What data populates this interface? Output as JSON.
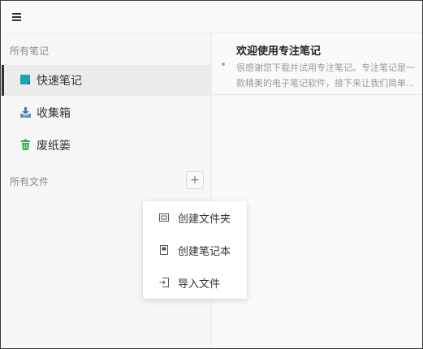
{
  "sidebar": {
    "section_notes": "所有笔记",
    "items": [
      {
        "label": "快速笔记",
        "icon": "quick-note-icon",
        "color": "#1aa3b8",
        "active": true
      },
      {
        "label": "收集箱",
        "icon": "inbox-download-icon",
        "color": "#3d7fc1",
        "active": false
      },
      {
        "label": "废纸篓",
        "icon": "trash-icon",
        "color": "#2eaa4a",
        "active": false
      }
    ],
    "section_files": "所有文件",
    "add_label": "+"
  },
  "dropdown": {
    "items": [
      {
        "label": "创建文件夹",
        "icon": "folder-create-icon"
      },
      {
        "label": "创建笔记本",
        "icon": "notebook-create-icon"
      },
      {
        "label": "导入文件",
        "icon": "import-file-icon"
      }
    ]
  },
  "notes": [
    {
      "title": "欢迎使用专注笔记",
      "excerpt": "很感谢您下载并试用专注笔记。专注笔记是一款精美的电子笔记软件，接下来让我们简单..."
    }
  ]
}
